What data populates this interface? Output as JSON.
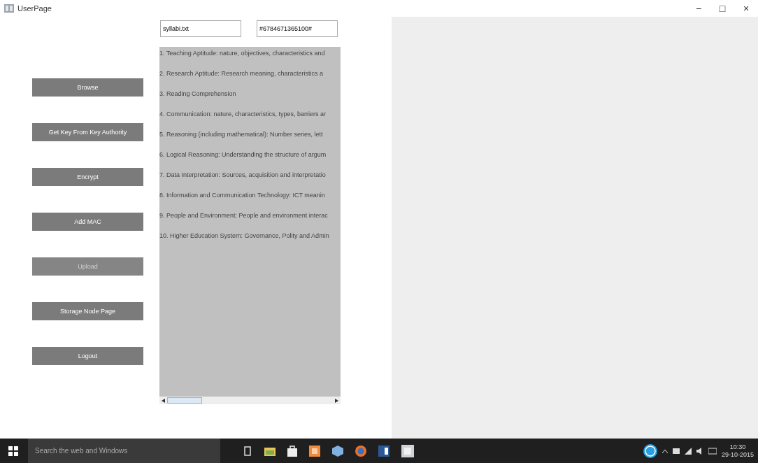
{
  "window": {
    "title": "UserPage",
    "controls": [
      "−",
      "□",
      "×"
    ]
  },
  "buttons": [
    {
      "label": "Browse",
      "disabled": false
    },
    {
      "label": "Get Key From Key Authority",
      "disabled": false
    },
    {
      "label": "Encrypt",
      "disabled": false
    },
    {
      "label": "Add MAC",
      "disabled": false
    },
    {
      "label": "Upload",
      "disabled": true
    },
    {
      "label": "Storage Node Page",
      "disabled": false
    },
    {
      "label": "Logout",
      "disabled": false
    }
  ],
  "file_field": {
    "value": "syllabi.txt"
  },
  "key_field": {
    "value": "#6784671365100#"
  },
  "text_area": {
    "lines": [
      "1. Teaching Aptitude: nature, objectives, characteristics and",
      "2. Research Aptitude: Research meaning, characteristics a",
      "3. Reading Comprehension",
      "4. Communication: nature, characteristics, types, barriers ar",
      "5. Reasoning (including mathematical): Number series, lett",
      "6. Logical Reasoning: Understanding the structure of argum",
      "7. Data Interpretation: Sources, acquisition and interpretatio",
      "8. Information and Communication Technology: ICT meanin",
      "9. People and Environment: People and environment interac",
      "10. Higher Education System: Governance, Polity and Admin"
    ]
  },
  "taskbar": {
    "search": {
      "placeholder": "Search the web and Windows"
    },
    "time": "10:30",
    "date": "29-10-2015"
  }
}
